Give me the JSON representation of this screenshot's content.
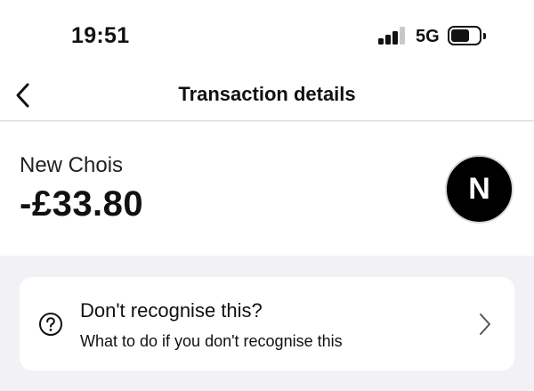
{
  "status_bar": {
    "time": "19:51",
    "network": "5G",
    "signal_bars_active": 3,
    "signal_bars_total": 4
  },
  "nav": {
    "title": "Transaction details",
    "back_icon": "chevron-left-icon"
  },
  "transaction": {
    "merchant": "New Chois",
    "amount": "-£33.80",
    "avatar_initial": "N"
  },
  "help": {
    "icon": "question-icon",
    "title": "Don't recognise this?",
    "subtitle": "What to do if you don't recognise this",
    "chevron_icon": "chevron-right-icon"
  },
  "colors": {
    "background": "#f2f2f6",
    "card": "#ffffff",
    "text": "#111111",
    "avatar": "#000000",
    "signal_inactive": "#c7c7cc"
  }
}
